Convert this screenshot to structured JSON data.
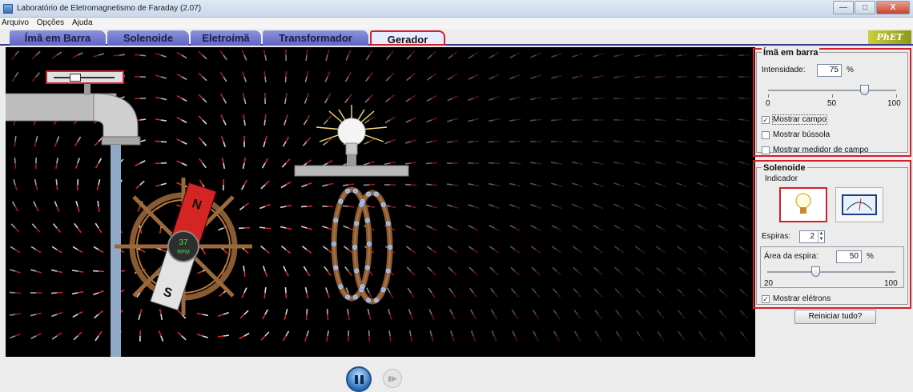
{
  "window": {
    "title": "Laboratório de Eletromagnetismo de Faraday (2.07)",
    "minimize": "—",
    "maximize": "□",
    "close": "X"
  },
  "menu": [
    "Arquivo",
    "Opções",
    "Ajuda"
  ],
  "tabs": [
    {
      "label": "Ímã em Barra",
      "active": false
    },
    {
      "label": "Solenoide",
      "active": false
    },
    {
      "label": "Eletroímã",
      "active": false
    },
    {
      "label": "Transformador",
      "active": false
    },
    {
      "label": "Gerador",
      "active": true
    }
  ],
  "logo": "PhET",
  "simulation": {
    "rpm_value": "37",
    "rpm_unit": "RPM",
    "magnet_north": "N",
    "magnet_south": "S"
  },
  "bar_magnet_panel": {
    "title": "Ímã em barra",
    "strength_label": "Intensidade:",
    "strength_value": "75",
    "strength_unit": "%",
    "strength_level": 0.75,
    "scale": [
      "0",
      "50",
      "100"
    ],
    "show_field": {
      "label": "Mostrar campo",
      "checked": true
    },
    "show_compass": {
      "label": "Mostrar bússola",
      "checked": false
    },
    "show_field_meter": {
      "label": "Mostrar medidor de campo",
      "checked": false
    }
  },
  "coil_panel": {
    "title": "Solenoide",
    "indicator_label": "Indicador",
    "loops_label": "Espiras:",
    "loops_value": "2",
    "area_label": "Área da espira:",
    "area_value": "50",
    "area_unit": "%",
    "area_level": 0.375,
    "scale": [
      "20",
      "100"
    ],
    "show_electrons": {
      "label": "Mostrar elétrons",
      "checked": true
    }
  },
  "reset_label": "Reiniciar tudo?",
  "checkmark": "✓",
  "colors": {
    "highlight": "#d3202a",
    "tab_blue": "#6b71c9",
    "canvas_bg": "#000000"
  }
}
